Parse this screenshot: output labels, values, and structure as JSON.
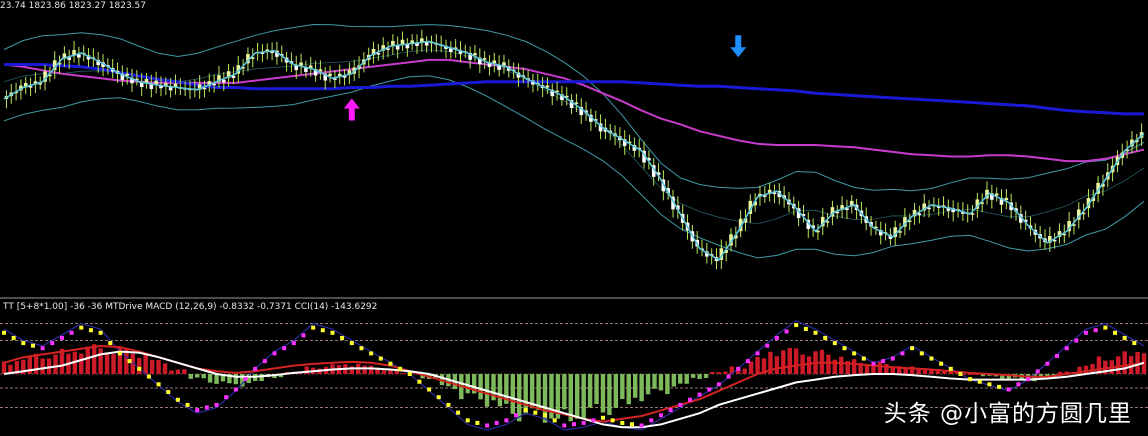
{
  "price_header": "23.74 1823.86 1823.27 1823.57",
  "indicator_header": "TT [5+8*1.00]  -36 -36  MTDrive MACD (12,26,9)  -0.8332  -0.7371   CCI(14)  -143.6292",
  "watermark": "头条 @小富的方圆几里",
  "colors": {
    "background": "#000000",
    "separator": "#9a9a9a",
    "candle_up": "#eaf5a0",
    "candle_down": "#ffffff",
    "candle_wick": "#b9ea5a",
    "fast_line": "#5fc6d8",
    "bollinger": "#3f9aa8",
    "ma_blue": "#1a1ad6",
    "ma_magenta": "#c83ccc",
    "arrow_buy": "#ff1aff",
    "arrow_sell": "#1f8fff",
    "hist_positive": "#cc1a28",
    "hist_negative": "#7db85a",
    "macd_signal": "#d22222",
    "macd_line": "#ffffff",
    "cci_line": "#2a2aa0",
    "dots_yellow": "#ffff2a",
    "dots_magenta": "#ff33ff",
    "level_lines": "#c9a0a0"
  },
  "chart_data": [
    {
      "type": "line",
      "title": "",
      "x_count": 60,
      "y_axis_labels": "none visible",
      "series": [
        {
          "name": "",
          "role": "close",
          "values": [
            0.4,
            0.5,
            0.55,
            0.75,
            0.8,
            0.72,
            0.62,
            0.55,
            0.52,
            0.5,
            0.48,
            0.55,
            0.62,
            0.8,
            0.82,
            0.7,
            0.66,
            0.58,
            0.62,
            0.78,
            0.86,
            0.88,
            0.9,
            0.85,
            0.8,
            0.72,
            0.68,
            0.58,
            0.5,
            0.42,
            0.3,
            0.15,
            0.05,
            -0.05,
            -0.3,
            -0.6,
            -0.9,
            -1.0,
            -0.75,
            -0.45,
            -0.4,
            -0.55,
            -0.75,
            -0.58,
            -0.52,
            -0.72,
            -0.8,
            -0.62,
            -0.52,
            -0.55,
            -0.6,
            -0.42,
            -0.5,
            -0.7,
            -0.85,
            -0.75,
            -0.55,
            -0.3,
            -0.05,
            0.1
          ]
        },
        {
          "name": "",
          "role": "ma_blue",
          "values": [
            0.7,
            0.7,
            0.7,
            0.69,
            0.68,
            0.66,
            0.63,
            0.6,
            0.57,
            0.55,
            0.52,
            0.5,
            0.5,
            0.49,
            0.49,
            0.49,
            0.49,
            0.49,
            0.5,
            0.5,
            0.51,
            0.51,
            0.52,
            0.53,
            0.54,
            0.55,
            0.55,
            0.55,
            0.55,
            0.55,
            0.55,
            0.55,
            0.55,
            0.54,
            0.53,
            0.52,
            0.51,
            0.51,
            0.5,
            0.49,
            0.48,
            0.47,
            0.45,
            0.44,
            0.43,
            0.42,
            0.41,
            0.4,
            0.39,
            0.38,
            0.37,
            0.36,
            0.35,
            0.34,
            0.32,
            0.3,
            0.29,
            0.28,
            0.27,
            0.27
          ]
        },
        {
          "name": "",
          "role": "ma_magenta",
          "values": [
            0.7,
            0.68,
            0.65,
            0.62,
            0.6,
            0.58,
            0.56,
            0.55,
            0.54,
            0.54,
            0.54,
            0.54,
            0.54,
            0.56,
            0.58,
            0.6,
            0.62,
            0.64,
            0.66,
            0.68,
            0.7,
            0.72,
            0.74,
            0.74,
            0.72,
            0.7,
            0.68,
            0.66,
            0.62,
            0.58,
            0.52,
            0.45,
            0.38,
            0.3,
            0.23,
            0.18,
            0.12,
            0.08,
            0.04,
            0.01,
            0.0,
            0.0,
            0.0,
            -0.01,
            -0.02,
            -0.04,
            -0.06,
            -0.08,
            -0.09,
            -0.1,
            -0.1,
            -0.09,
            -0.09,
            -0.1,
            -0.12,
            -0.14,
            -0.14,
            -0.12,
            -0.08,
            -0.04
          ]
        }
      ],
      "arrows": [
        {
          "direction": "up",
          "x_index": 18,
          "y_value": 0.3
        },
        {
          "direction": "down",
          "x_index": 38,
          "y_value": 0.85
        }
      ]
    },
    {
      "type": "bar",
      "title": "",
      "x_count": 60,
      "y_axis_labels": "none visible",
      "series": [
        {
          "name": "",
          "role": "macd_histogram",
          "values": [
            0.25,
            0.35,
            0.4,
            0.5,
            0.55,
            0.6,
            0.55,
            0.45,
            0.3,
            0.1,
            -0.1,
            -0.2,
            -0.25,
            -0.18,
            -0.08,
            0.05,
            0.15,
            0.2,
            0.22,
            0.18,
            0.1,
            0.02,
            -0.1,
            -0.3,
            -0.5,
            -0.65,
            -0.8,
            -0.95,
            -1.0,
            -1.0,
            -0.95,
            -0.85,
            -0.7,
            -0.55,
            -0.4,
            -0.25,
            -0.1,
            0.05,
            0.15,
            0.35,
            0.5,
            0.55,
            0.5,
            0.4,
            0.3,
            0.25,
            0.2,
            0.15,
            0.1,
            0.05,
            0.0,
            -0.05,
            -0.1,
            -0.15,
            -0.1,
            0.05,
            0.2,
            0.35,
            0.45,
            0.55
          ]
        },
        {
          "name": "",
          "role": "signal",
          "type": "line",
          "values": [
            0.2,
            0.3,
            0.35,
            0.4,
            0.45,
            0.5,
            0.48,
            0.4,
            0.3,
            0.2,
            0.1,
            0.05,
            0.02,
            0.05,
            0.1,
            0.15,
            0.18,
            0.2,
            0.22,
            0.2,
            0.15,
            0.05,
            -0.05,
            -0.15,
            -0.25,
            -0.35,
            -0.45,
            -0.55,
            -0.65,
            -0.72,
            -0.8,
            -0.85,
            -0.8,
            -0.75,
            -0.65,
            -0.55,
            -0.45,
            -0.3,
            -0.15,
            0.0,
            0.1,
            0.15,
            0.2,
            0.2,
            0.18,
            0.15,
            0.12,
            0.1,
            0.08,
            0.05,
            0.02,
            0.0,
            -0.02,
            -0.05,
            -0.05,
            0.0,
            0.05,
            0.1,
            0.15,
            0.2
          ]
        },
        {
          "name": "",
          "role": "macd_line",
          "type": "line",
          "values": [
            0.0,
            0.05,
            0.1,
            0.15,
            0.25,
            0.35,
            0.4,
            0.38,
            0.3,
            0.2,
            0.1,
            0.0,
            -0.05,
            -0.05,
            -0.02,
            0.02,
            0.05,
            0.08,
            0.1,
            0.1,
            0.08,
            0.05,
            0.0,
            -0.1,
            -0.2,
            -0.3,
            -0.4,
            -0.5,
            -0.6,
            -0.7,
            -0.8,
            -0.9,
            -0.95,
            -0.95,
            -0.9,
            -0.8,
            -0.7,
            -0.55,
            -0.45,
            -0.35,
            -0.25,
            -0.15,
            -0.1,
            -0.05,
            -0.02,
            0.0,
            0.0,
            -0.02,
            -0.05,
            -0.08,
            -0.1,
            -0.1,
            -0.1,
            -0.1,
            -0.08,
            -0.05,
            0.0,
            0.05,
            0.1,
            0.2
          ]
        },
        {
          "name": "",
          "role": "cci",
          "type": "line",
          "values": [
            0.8,
            0.6,
            0.5,
            0.7,
            0.9,
            0.8,
            0.4,
            0.1,
            -0.2,
            -0.5,
            -0.7,
            -0.6,
            -0.3,
            0.1,
            0.4,
            0.6,
            0.9,
            0.8,
            0.6,
            0.4,
            0.2,
            0.0,
            -0.3,
            -0.6,
            -0.9,
            -1.0,
            -0.9,
            -0.7,
            -0.8,
            -1.0,
            -0.95,
            -0.85,
            -0.95,
            -1.0,
            -0.8,
            -0.6,
            -0.4,
            -0.2,
            0.1,
            0.4,
            0.7,
            0.95,
            0.8,
            0.6,
            0.4,
            0.2,
            0.3,
            0.5,
            0.3,
            0.1,
            -0.1,
            -0.2,
            -0.3,
            -0.1,
            0.2,
            0.5,
            0.8,
            0.9,
            0.7,
            0.5
          ]
        }
      ],
      "levels": [
        0.9,
        0.6,
        -0.25,
        -0.6
      ]
    }
  ]
}
